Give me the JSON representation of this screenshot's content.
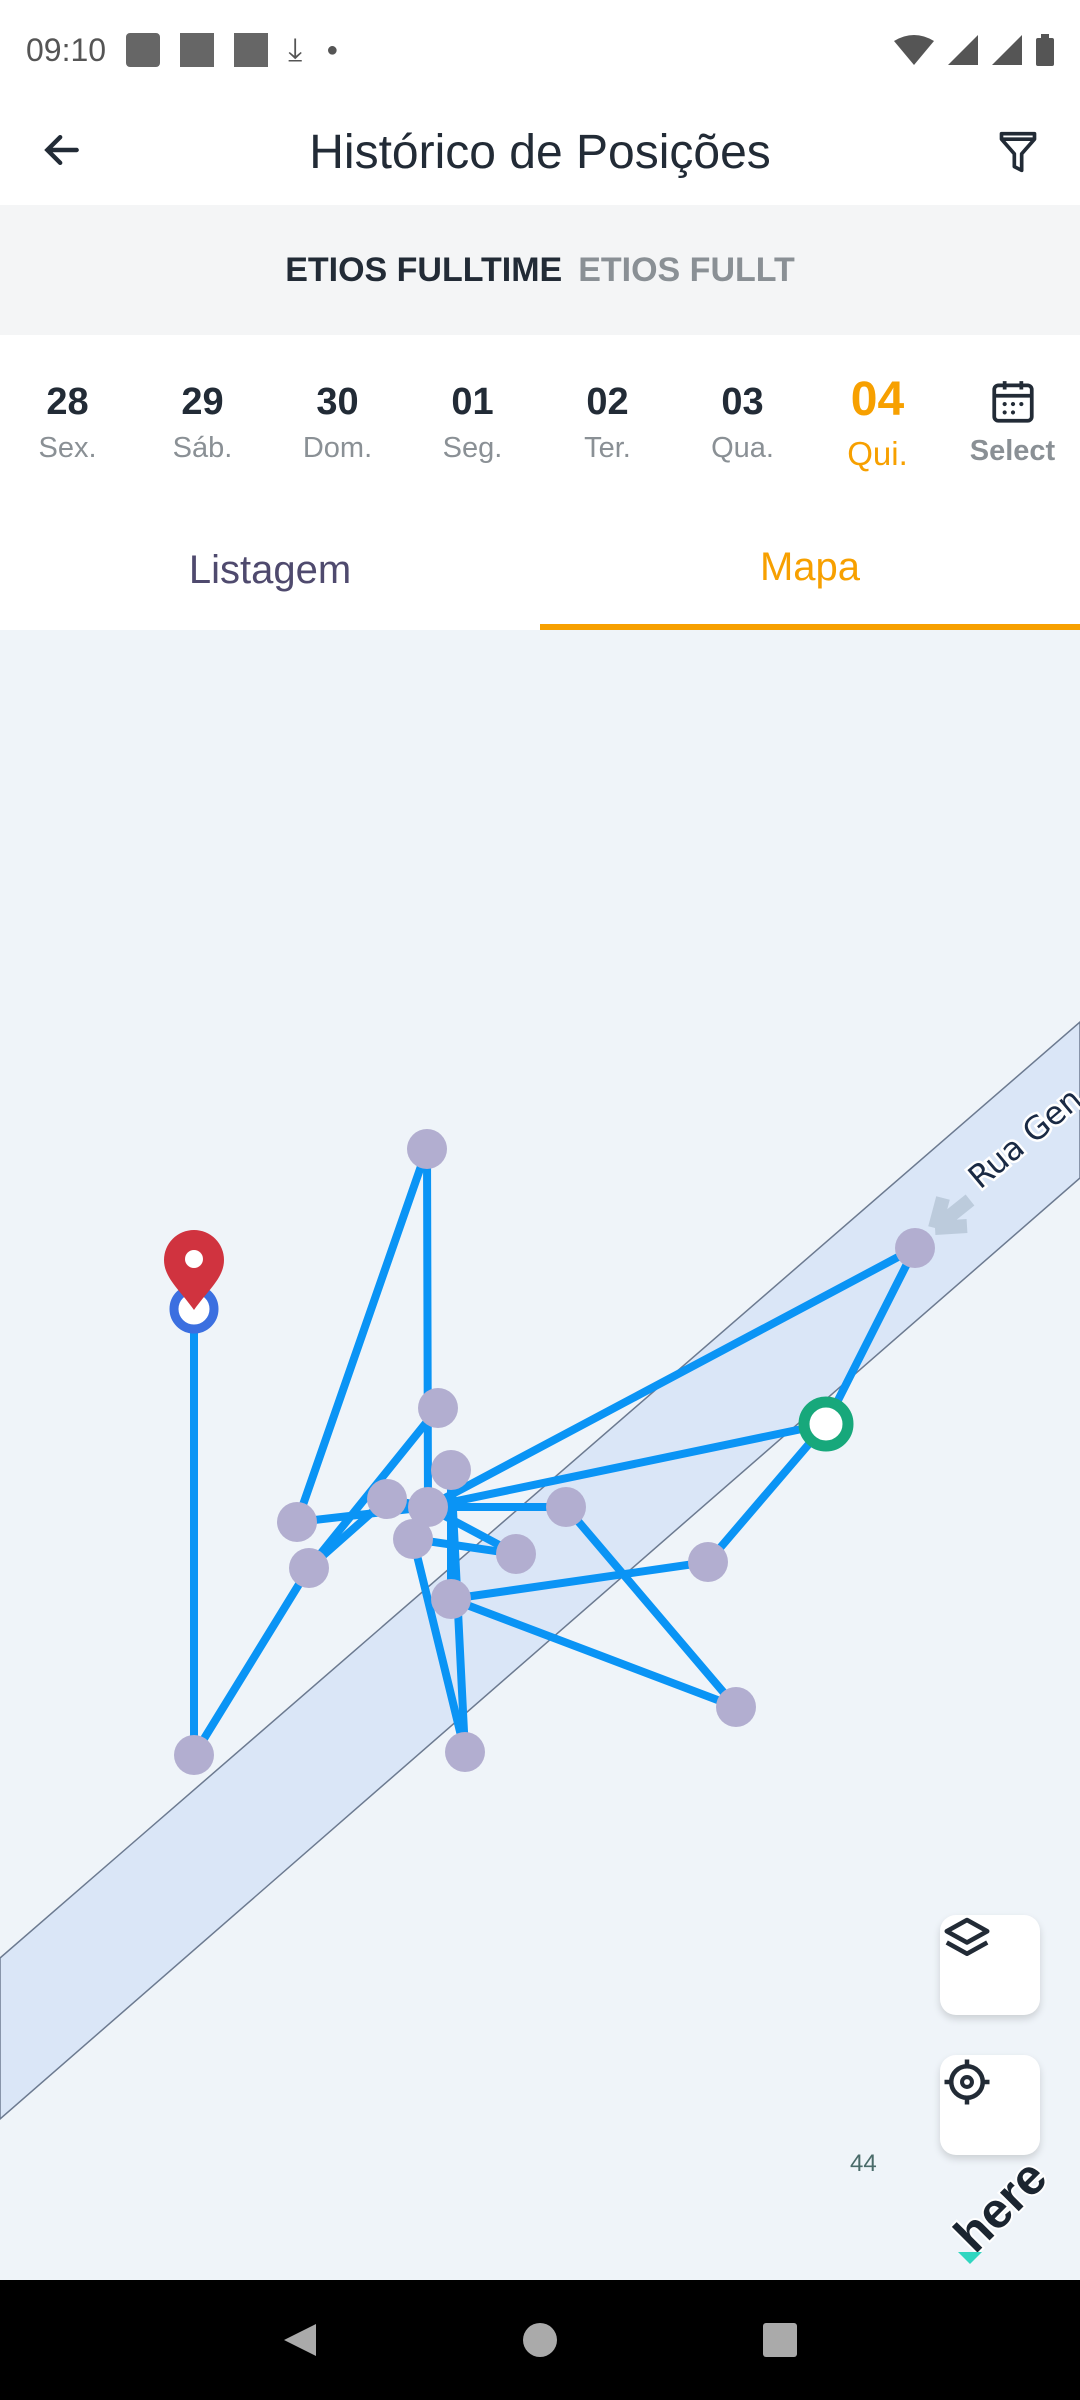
{
  "status_bar": {
    "time": "09:10"
  },
  "header": {
    "title": "Histórico de Posições"
  },
  "vehicle": {
    "primary": "ETIOS FULLTIME",
    "secondary": "ETIOS FULLT"
  },
  "dates": [
    {
      "day": "28",
      "weekday": "Sex."
    },
    {
      "day": "29",
      "weekday": "Sáb."
    },
    {
      "day": "30",
      "weekday": "Dom."
    },
    {
      "day": "01",
      "weekday": "Seg."
    },
    {
      "day": "02",
      "weekday": "Ter."
    },
    {
      "day": "03",
      "weekday": "Qua."
    },
    {
      "day": "04",
      "weekday": "Qui.",
      "selected": true
    }
  ],
  "select_label": "Select",
  "tabs": [
    {
      "label": "Listagem"
    },
    {
      "label": "Mapa",
      "active": true
    }
  ],
  "map": {
    "street_label": "Rua Gen",
    "scale_text": "44",
    "logo": "here",
    "colors": {
      "route": "#0a94f5",
      "point": "#b2aed0",
      "start": "#3b6fe0",
      "end": "#17a87b",
      "pin": "#d0333f"
    }
  }
}
